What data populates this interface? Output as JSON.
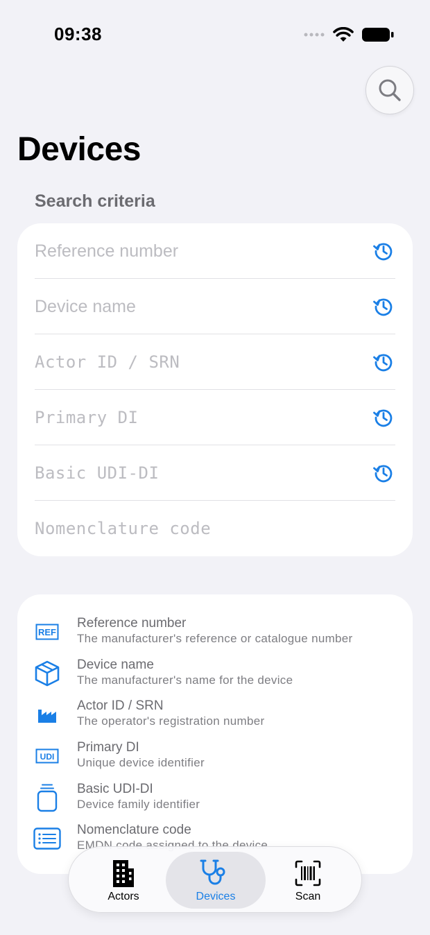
{
  "status_bar": {
    "time": "09:38"
  },
  "page": {
    "title": "Devices",
    "section_label": "Search criteria"
  },
  "form": {
    "fields": [
      {
        "placeholder": "Reference number",
        "has_history": true
      },
      {
        "placeholder": "Device name",
        "has_history": true
      },
      {
        "placeholder": "Actor ID / SRN",
        "has_history": true
      },
      {
        "placeholder": "Primary DI",
        "has_history": true
      },
      {
        "placeholder": "Basic UDI-DI",
        "has_history": true
      },
      {
        "placeholder": "Nomenclature code",
        "has_history": false
      }
    ]
  },
  "help": {
    "items": [
      {
        "icon": "ref-icon",
        "title": "Reference number",
        "description": "The manufacturer's reference or catalogue number"
      },
      {
        "icon": "box-icon",
        "title": "Device name",
        "description": "The manufacturer's name for the device"
      },
      {
        "icon": "factory-icon",
        "title": "Actor ID / SRN",
        "description": "The operator's registration number"
      },
      {
        "icon": "udi-icon",
        "title": "Primary DI",
        "description": "Unique device identifier"
      },
      {
        "icon": "container-icon",
        "title": "Basic UDI-DI",
        "description": "Device family identifier"
      },
      {
        "icon": "list-icon",
        "title": "Nomenclature code",
        "description": "EMDN code assigned to the device"
      }
    ]
  },
  "tabs": [
    {
      "label": "Actors",
      "icon": "building-icon",
      "active": false
    },
    {
      "label": "Devices",
      "icon": "stethoscope-icon",
      "active": true
    },
    {
      "label": "Scan",
      "icon": "barcode-scan-icon",
      "active": false
    }
  ],
  "colors": {
    "accent": "#1a7fe6",
    "background": "#f2f2f7",
    "card": "#ffffff",
    "placeholder": "#bcbcc1"
  }
}
